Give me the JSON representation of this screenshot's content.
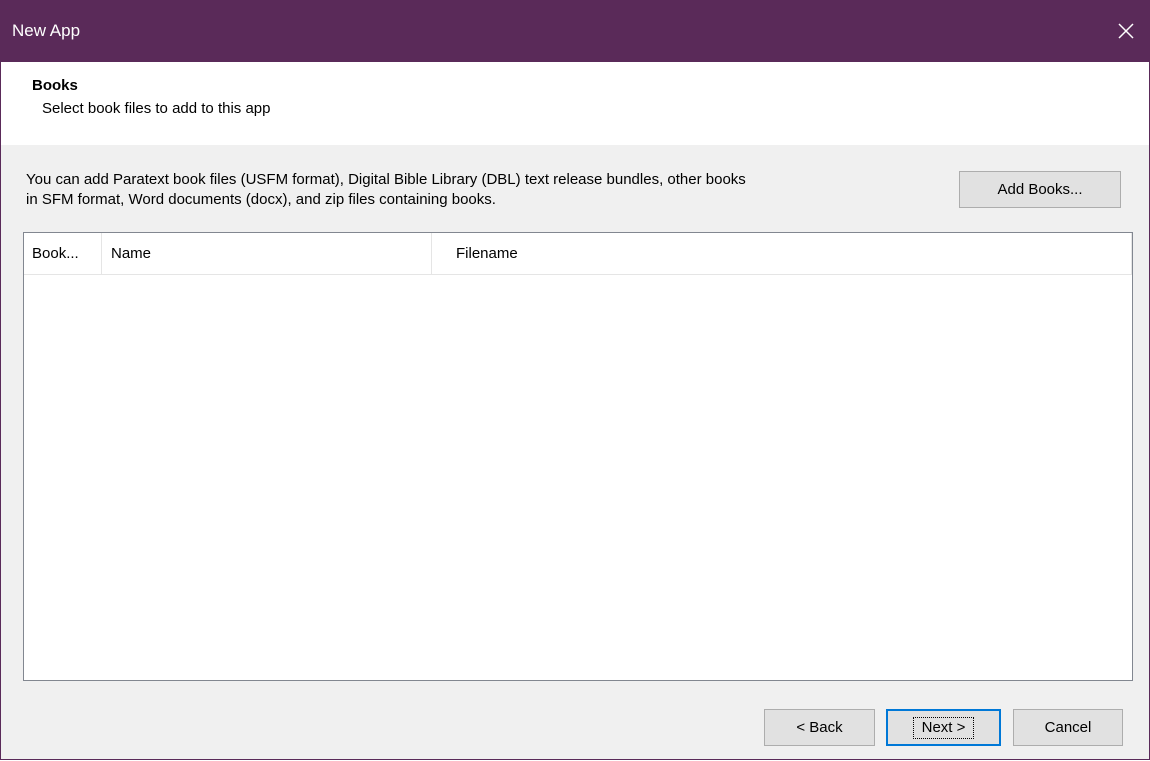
{
  "window": {
    "title": "New App",
    "close_icon": "close-icon"
  },
  "header": {
    "title": "Books",
    "subtitle": "Select book files to add to this app"
  },
  "description": {
    "line1": "You can add Paratext book files (USFM format), Digital Bible Library (DBL) text release bundles, other books",
    "line2": "in SFM format, Word documents (docx), and zip files containing books."
  },
  "buttons": {
    "add_books": "Add Books...",
    "back": "< Back",
    "next": "Next >",
    "cancel": "Cancel"
  },
  "list": {
    "columns": [
      "Book...",
      "Name",
      "Filename"
    ],
    "rows": []
  },
  "colors": {
    "titlebar": "#5a2a59",
    "accent_focus": "#0078d7",
    "dialog_background": "#f0f0f0"
  }
}
